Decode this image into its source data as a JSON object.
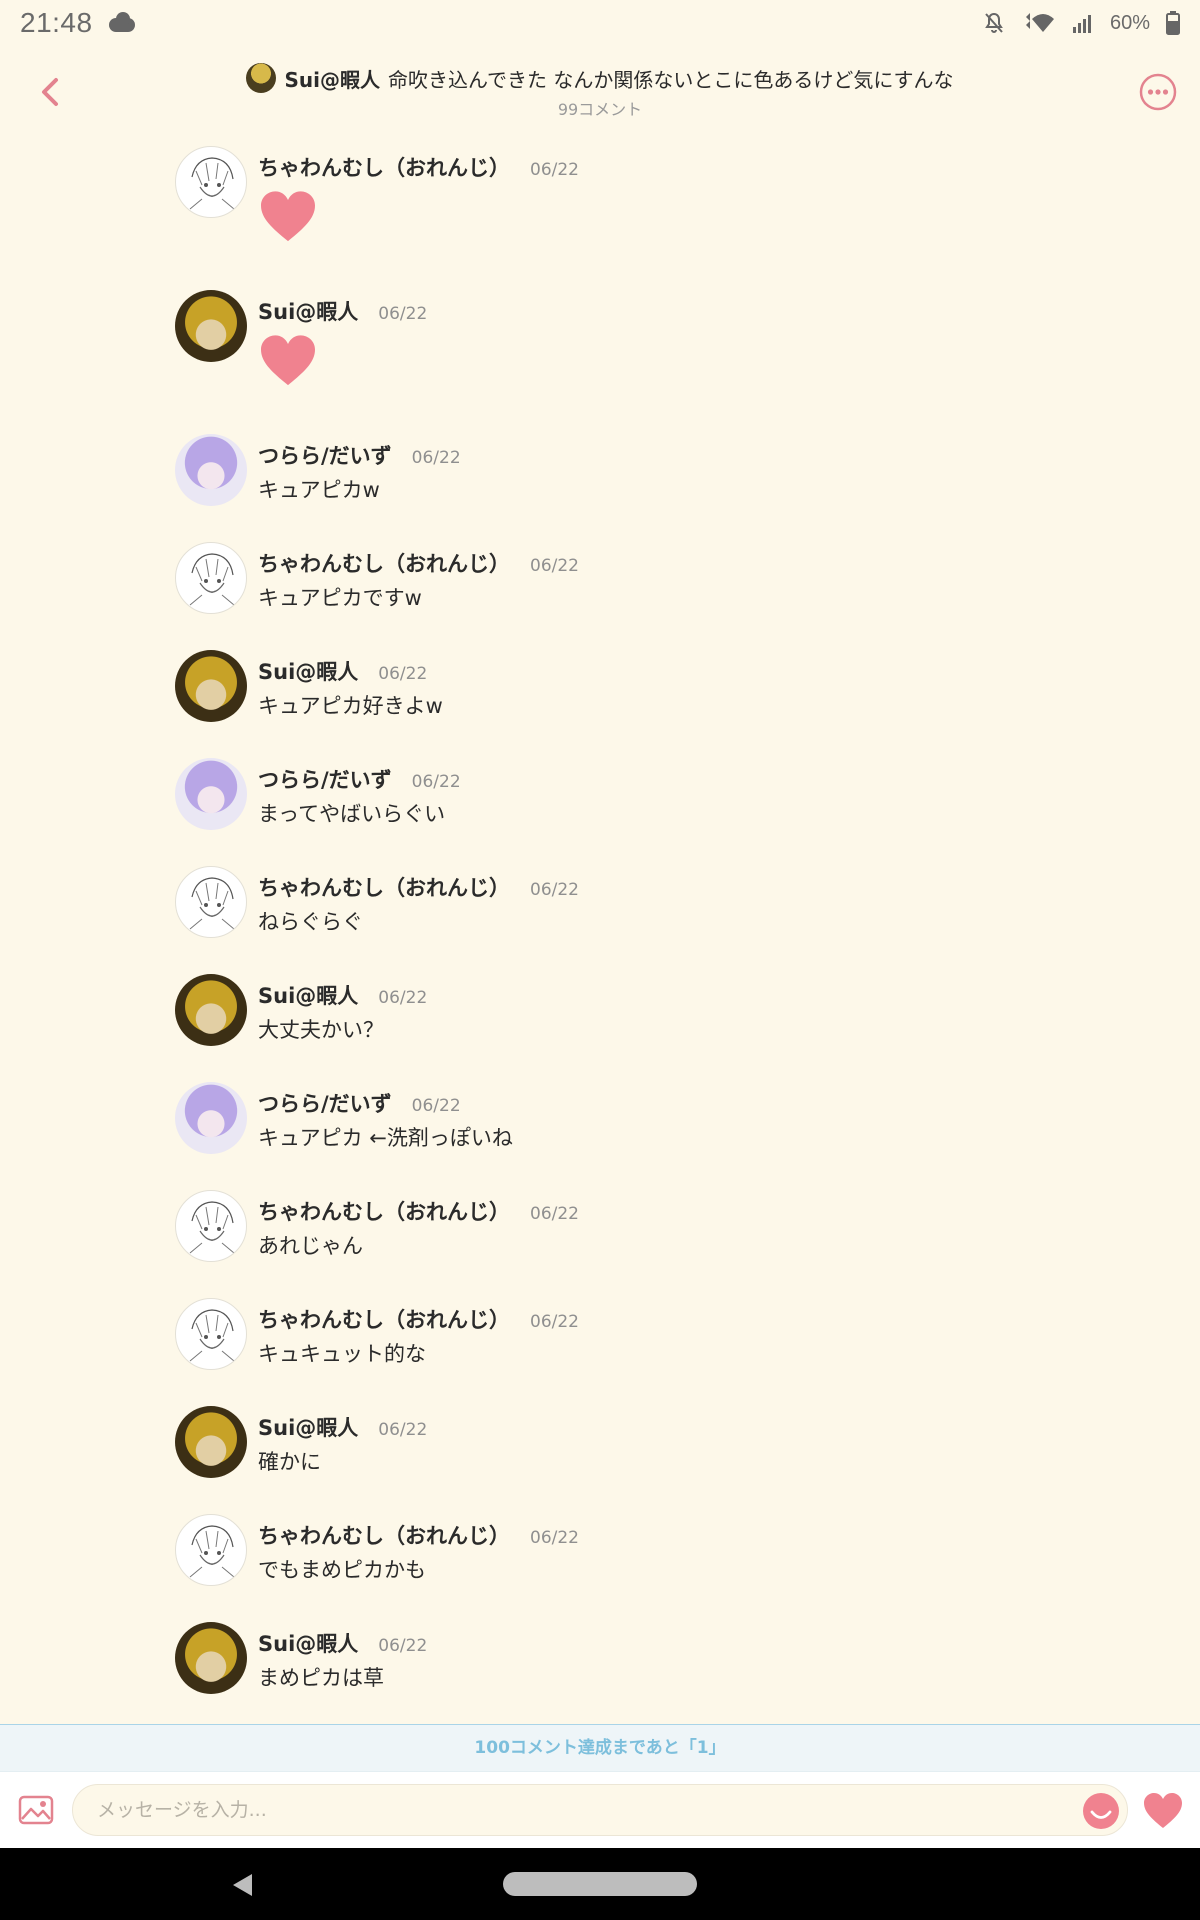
{
  "status_bar": {
    "time": "21:48",
    "battery_percent": "60%",
    "icons": [
      "weather-cloud-icon",
      "notifications-off-icon",
      "wifi-icon",
      "cell-signal-icon",
      "battery-icon"
    ]
  },
  "header": {
    "author": "Sui@暇人",
    "title": "命吹き込んできた なんか関係ないとこに色あるけど気にすんな",
    "comment_count": "99コメント",
    "icons": [
      "back-chevron-icon",
      "more-options-icon"
    ]
  },
  "colors": {
    "background": "#fdf8e9",
    "accent_pink": "#f0828f",
    "banner_blue": "#7dbfdc"
  },
  "messages": [
    {
      "name": "ちゃわんむし（おれんじ）",
      "date": "06/22",
      "text": "",
      "sticker": "heart-sticker",
      "avatar": "sketch"
    },
    {
      "name": "Sui@暇人",
      "date": "06/22",
      "text": "",
      "sticker": "heart-sticker",
      "avatar": "gold"
    },
    {
      "name": "つらら/だいず",
      "date": "06/22",
      "text": "キュアピカw",
      "avatar": "purple"
    },
    {
      "name": "ちゃわんむし（おれんじ）",
      "date": "06/22",
      "text": "キュアピカですw",
      "avatar": "sketch"
    },
    {
      "name": "Sui@暇人",
      "date": "06/22",
      "text": "キュアピカ好きよw",
      "avatar": "gold"
    },
    {
      "name": "つらら/だいず",
      "date": "06/22",
      "text": "まってやばいらぐい",
      "avatar": "purple"
    },
    {
      "name": "ちゃわんむし（おれんじ）",
      "date": "06/22",
      "text": "ねらぐらぐ",
      "avatar": "sketch"
    },
    {
      "name": "Sui@暇人",
      "date": "06/22",
      "text": "大丈夫かい？",
      "avatar": "gold"
    },
    {
      "name": "つらら/だいず",
      "date": "06/22",
      "text": "キュアピカ ←洗剤っぽいね",
      "avatar": "purple"
    },
    {
      "name": "ちゃわんむし（おれんじ）",
      "date": "06/22",
      "text": "あれじゃん",
      "avatar": "sketch"
    },
    {
      "name": "ちゃわんむし（おれんじ）",
      "date": "06/22",
      "text": "キュキュット的な",
      "avatar": "sketch"
    },
    {
      "name": "Sui@暇人",
      "date": "06/22",
      "text": "確かに",
      "avatar": "gold"
    },
    {
      "name": "ちゃわんむし（おれんじ）",
      "date": "06/22",
      "text": "でもまめピカかも",
      "avatar": "sketch"
    },
    {
      "name": "Sui@暇人",
      "date": "06/22",
      "text": "まめピカは草",
      "avatar": "gold"
    }
  ],
  "milestone": {
    "text": "100コメント達成まであと「1」"
  },
  "composer": {
    "placeholder": "メッセージを入力...",
    "value": "",
    "icons": [
      "image-icon",
      "emoji-icon",
      "heart-icon"
    ]
  }
}
